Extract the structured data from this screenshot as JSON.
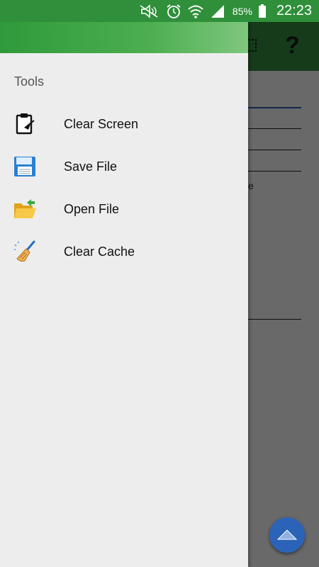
{
  "status_bar": {
    "battery": "85%",
    "time": "22:23",
    "icons": [
      "mute-icon",
      "alarm-icon",
      "wifi-icon",
      "signal-icon",
      "battery-icon"
    ]
  },
  "app": {
    "toolbar_color": "#358c3f",
    "help_label": "?",
    "partial_text": "e"
  },
  "drawer": {
    "section_title": "Tools",
    "items": [
      {
        "label": "Clear Screen",
        "icon": "clipboard-icon"
      },
      {
        "label": "Save File",
        "icon": "floppy-disk-icon"
      },
      {
        "label": "Open File",
        "icon": "open-folder-icon"
      },
      {
        "label": "Clear Cache",
        "icon": "broom-icon"
      }
    ]
  },
  "colors": {
    "accent_green": "#2f8f3a",
    "fab_blue": "#2b63b8",
    "drawer_bg": "#ededed"
  }
}
